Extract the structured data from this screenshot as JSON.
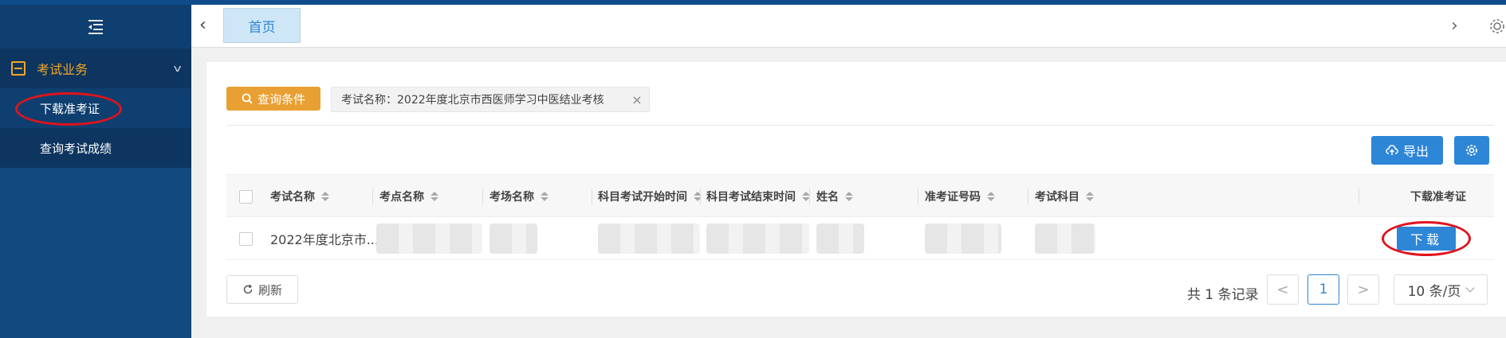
{
  "sidebar": {
    "toggle_icon": "menu-fold-icon",
    "group": {
      "label": "考试业务",
      "icon": "book-icon"
    },
    "items": [
      {
        "label": "下载准考证",
        "active": true
      },
      {
        "label": "查询考试成绩",
        "active": false
      }
    ]
  },
  "tabs": {
    "items": [
      {
        "label": "首页"
      }
    ]
  },
  "filter": {
    "query_label": "查询条件",
    "tag": "考试名称：2022年度北京市西医师学习中医结业考核",
    "tag_close": "×"
  },
  "toolbar": {
    "export_label": "导出"
  },
  "table": {
    "headers": [
      "考试名称",
      "考点名称",
      "考场名称",
      "科目考试开始时间",
      "科目考试结束时间",
      "姓名",
      "准考证号码",
      "考试科目",
      "下载准考证"
    ],
    "rows": [
      {
        "exam_name": "2022年度北京市...",
        "download_label": "下载"
      }
    ]
  },
  "footer": {
    "refresh_label": "刷新",
    "total": "共 1 条记录",
    "prev": "<",
    "current_page": "1",
    "next": ">",
    "page_size": "10 条/页"
  },
  "colors": {
    "sidebar_bg": "#12497f",
    "accent_orange": "#e9a032",
    "primary_blue": "#2e86d6",
    "annotation_red": "#e0131d"
  }
}
